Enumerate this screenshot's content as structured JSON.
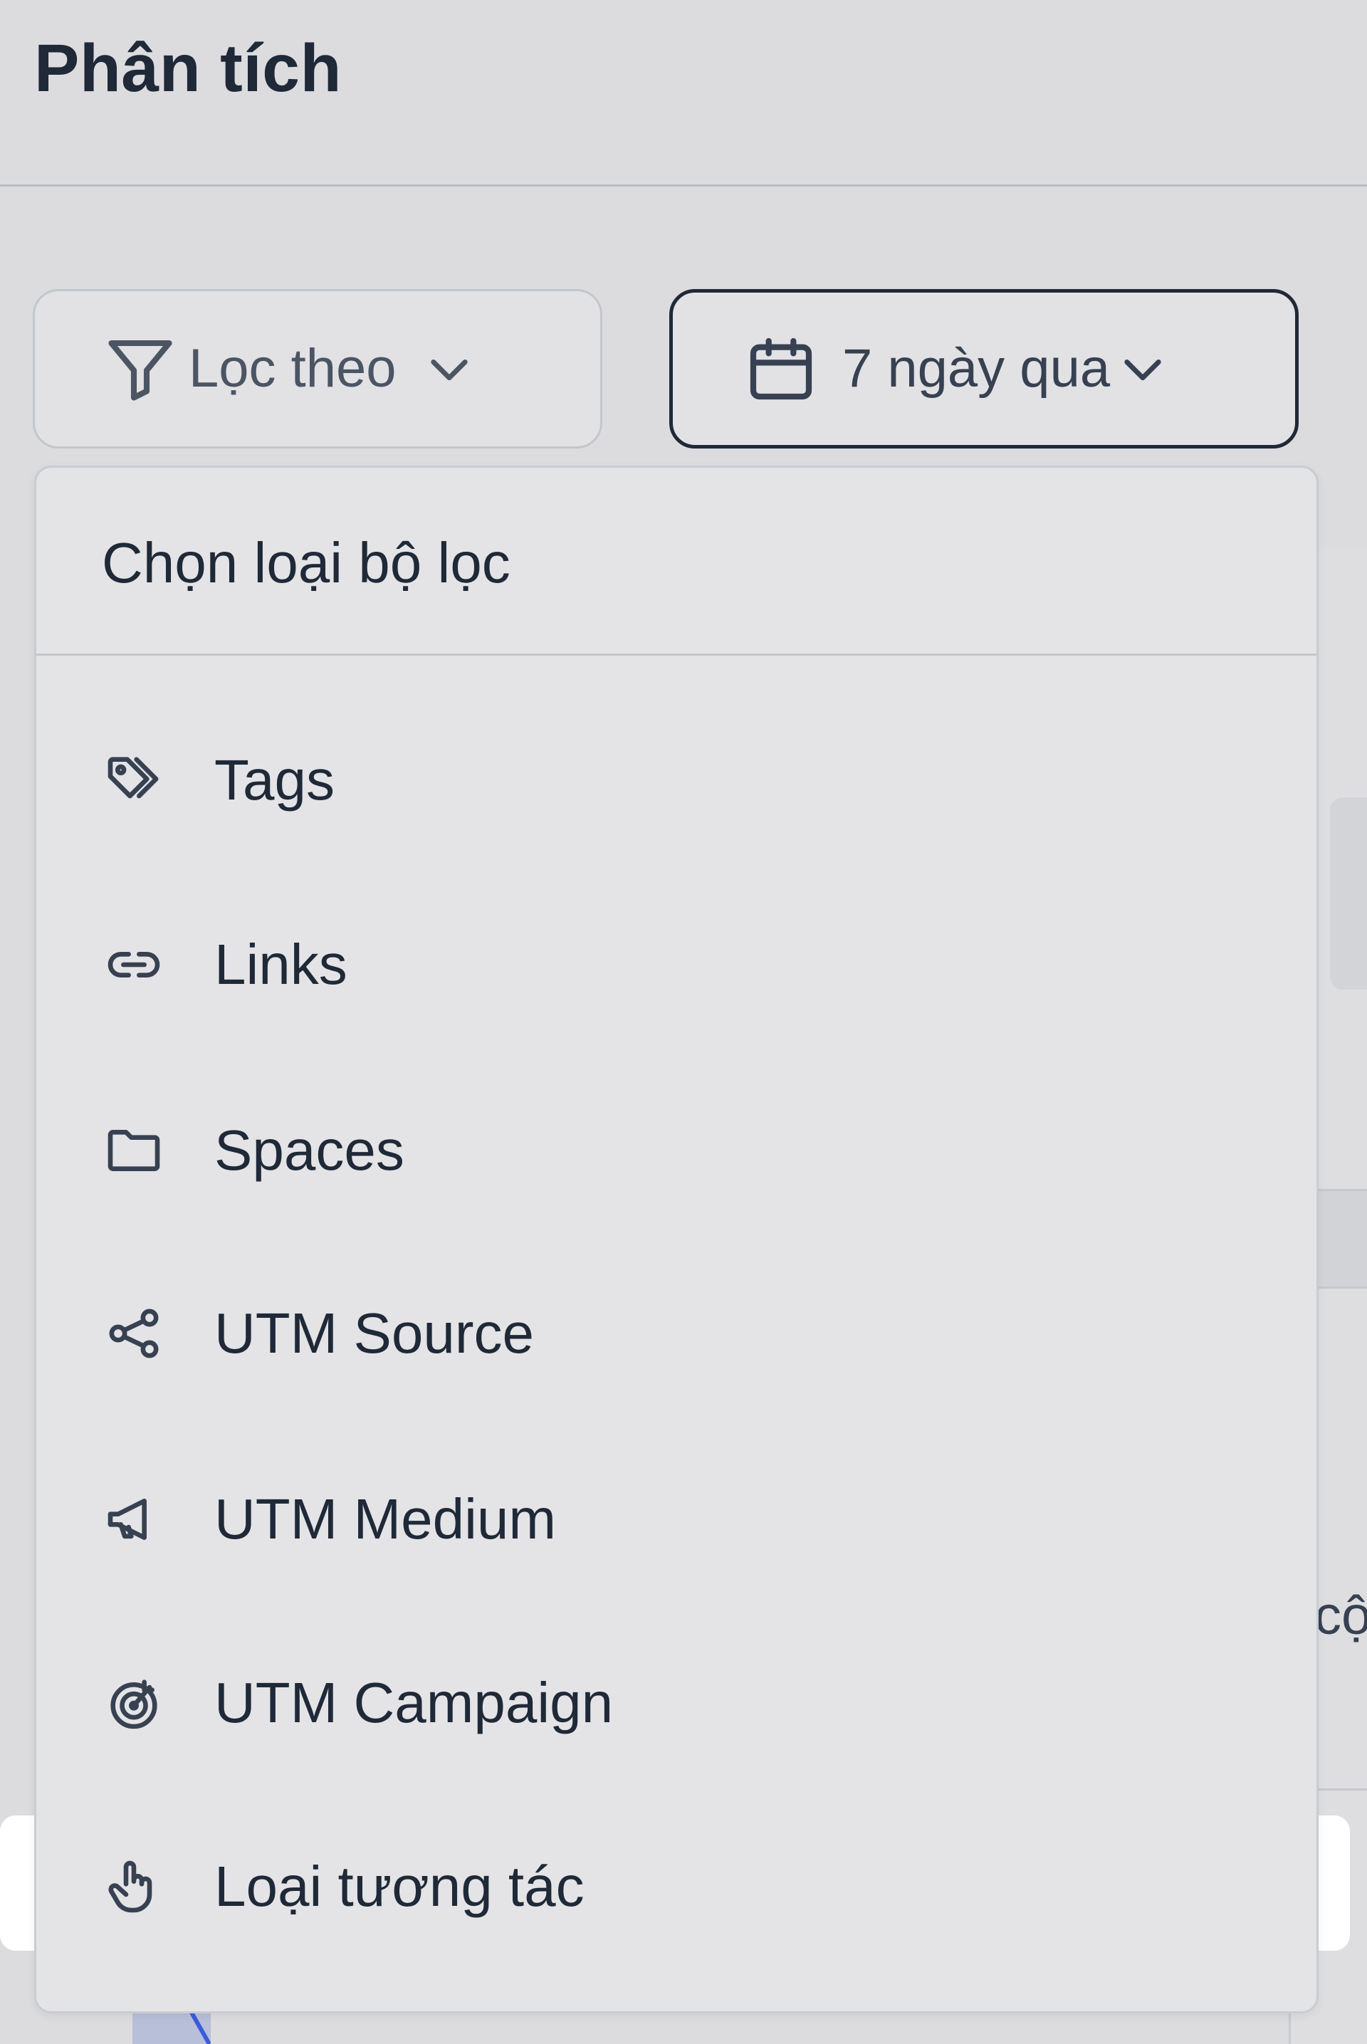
{
  "header": {
    "title": "Phân tích"
  },
  "toolbar": {
    "filter_label": "Lọc theo",
    "date_label": "7 ngày qua"
  },
  "dropdown": {
    "title": "Chọn loại bộ lọc",
    "items": [
      {
        "label": "Tags",
        "icon": "tags-icon"
      },
      {
        "label": "Links",
        "icon": "link-icon"
      },
      {
        "label": "Spaces",
        "icon": "folder-icon"
      },
      {
        "label": "UTM Source",
        "icon": "share-icon"
      },
      {
        "label": "UTM Medium",
        "icon": "megaphone-icon"
      },
      {
        "label": "UTM Campaign",
        "icon": "target-icon"
      },
      {
        "label": "Loại tương tác",
        "icon": "pointer-hand-icon",
        "highlighted": true
      }
    ]
  },
  "background": {
    "fragment_text": "cộ"
  },
  "colors": {
    "page_bg": "#dcdcdf",
    "text": "#1f2937",
    "border": "#c3c6cc",
    "highlight": "#ffffff",
    "chart_line": "#3b5bdb"
  }
}
